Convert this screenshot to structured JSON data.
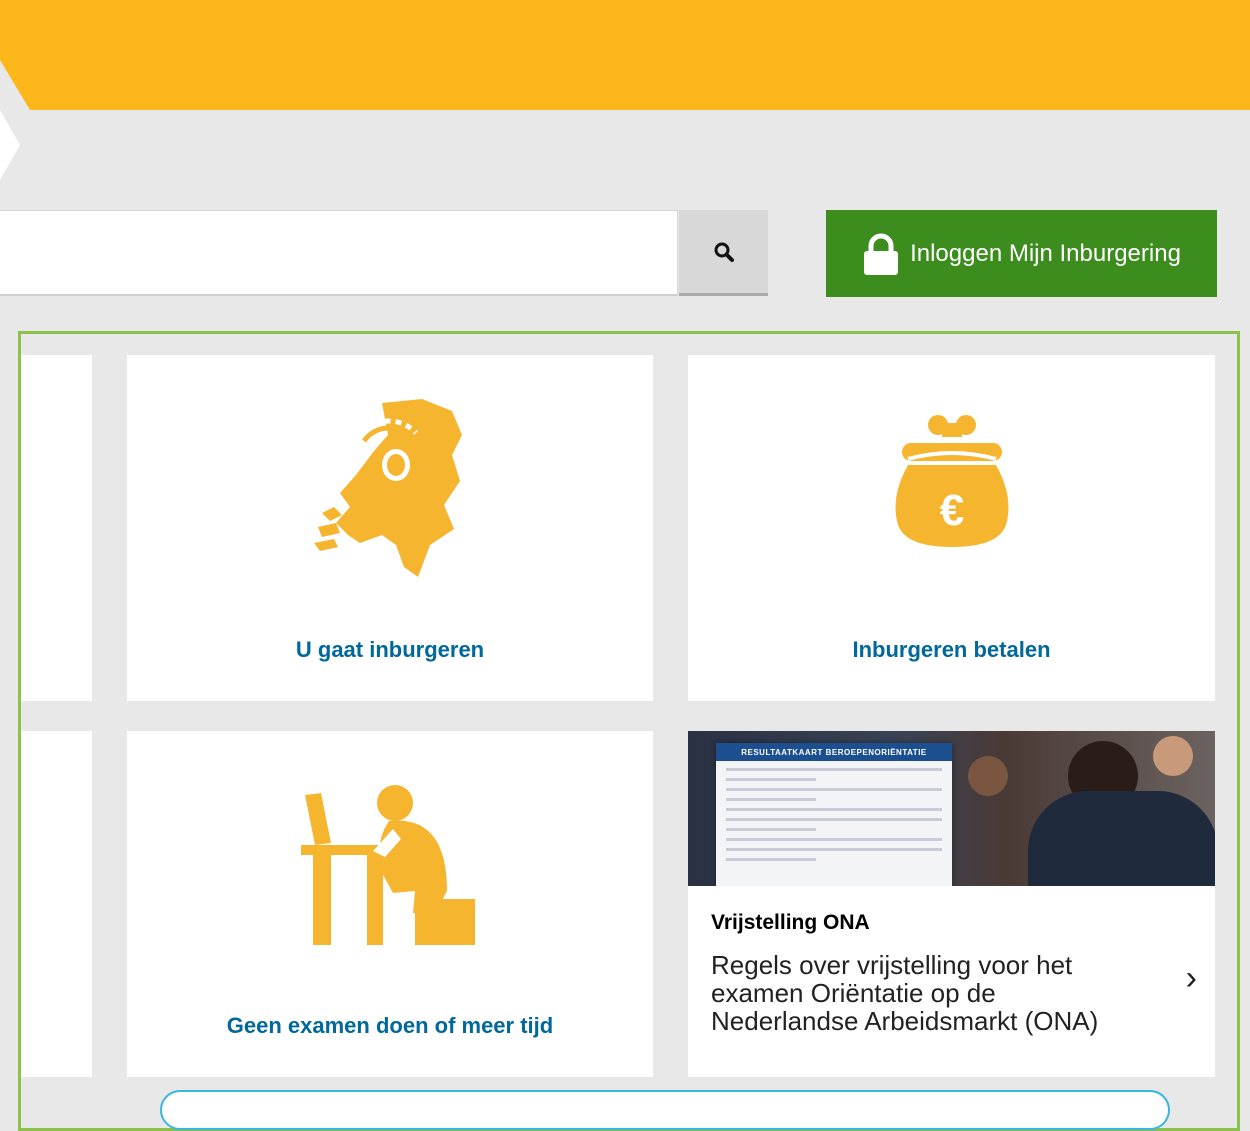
{
  "search": {
    "value": "",
    "placeholder": ""
  },
  "login": {
    "label": "Inloggen Mijn Inburgering"
  },
  "tiles": [
    {
      "title": "U gaat inburgeren",
      "icon": "netherlands-map-headphones-icon"
    },
    {
      "title": "Inburgeren betalen",
      "icon": "money-purse-euro-icon"
    },
    {
      "title": "Geen examen doen of meer tijd",
      "icon": "person-at-desk-laptop-icon"
    }
  ],
  "news": {
    "title": "Vrijstelling ONA",
    "description": "Regels over vrijstelling voor het examen Oriëntatie op de Nederlandse Arbeidsmarkt (ONA)",
    "image_caption": "RESULTAATKAART BEROEPENORIËNTATIE"
  },
  "colors": {
    "accent_yellow": "#fdb71a",
    "icon_orange": "#f6b52f",
    "login_green": "#3c8c1e",
    "link_blue": "#01689b",
    "frame_green": "#8bc34a",
    "box_blue": "#38b6e0"
  }
}
